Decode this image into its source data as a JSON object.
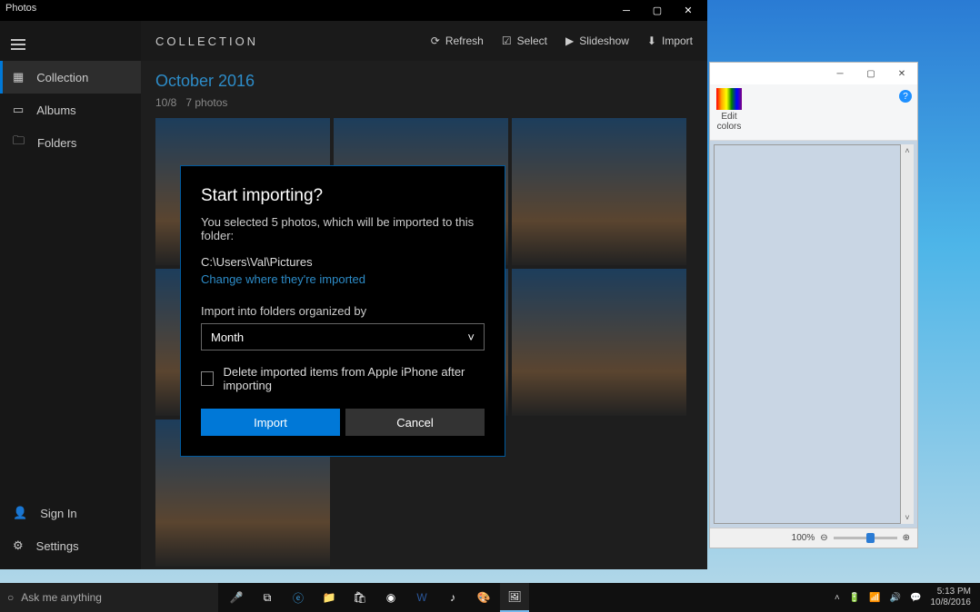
{
  "photos_app": {
    "title": "Photos",
    "header": "COLLECTION",
    "toolbar": {
      "refresh": "Refresh",
      "select": "Select",
      "slideshow": "Slideshow",
      "import": "Import"
    },
    "sidebar": {
      "collection": "Collection",
      "albums": "Albums",
      "folders": "Folders",
      "signin": "Sign In",
      "settings": "Settings"
    },
    "content": {
      "date_header": "October 2016",
      "date_sub_day": "10/8",
      "date_sub_count": "7 photos"
    },
    "dialog": {
      "title": "Start importing?",
      "message": "You selected 5 photos, which will be imported to this folder:",
      "path": "C:\\Users\\Val\\Pictures",
      "change_link": "Change where they're imported",
      "organize_label": "Import into folders organized by",
      "organize_value": "Month",
      "delete_label": "Delete imported items from Apple iPhone after importing",
      "import_btn": "Import",
      "cancel_btn": "Cancel"
    }
  },
  "paint_app": {
    "edit_colors": "Edit colors",
    "zoom_label": "100%"
  },
  "taskbar": {
    "search_placeholder": "Ask me anything",
    "time": "5:13 PM",
    "date": "10/8/2016"
  }
}
